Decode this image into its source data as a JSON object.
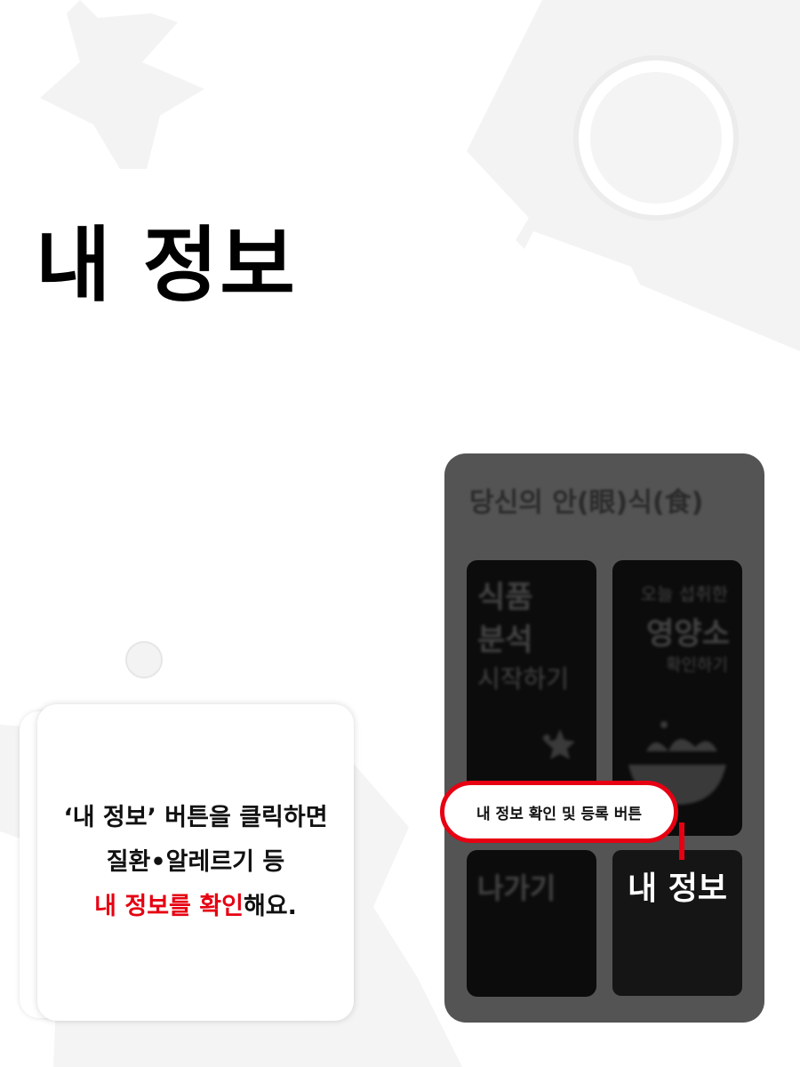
{
  "page": {
    "title": "내 정보"
  },
  "card": {
    "line1": "‘내 정보’ 버튼을 클릭하면",
    "line2": "질환•알레르기 등",
    "line3_highlight": "내 정보를 확인",
    "line3_rest": "해요."
  },
  "phone": {
    "app_title": "당신의 안(眼)식(食)",
    "tile_analysis": {
      "line1": "식품",
      "line2": "분석",
      "line3": "시작하기"
    },
    "tile_nutrients": {
      "line1": "오늘 섭취한",
      "line2": "영양소",
      "line3": "확인하기"
    },
    "tile_exit": {
      "label": "나가기"
    },
    "tile_myinfo": {
      "label": "내 정보"
    }
  },
  "callout": {
    "text": "내 정보 확인 및 등록 버튼"
  },
  "colors": {
    "accent": "#e60012",
    "phone_bg": "#545454",
    "tile_bg": "#0c0c0c"
  }
}
